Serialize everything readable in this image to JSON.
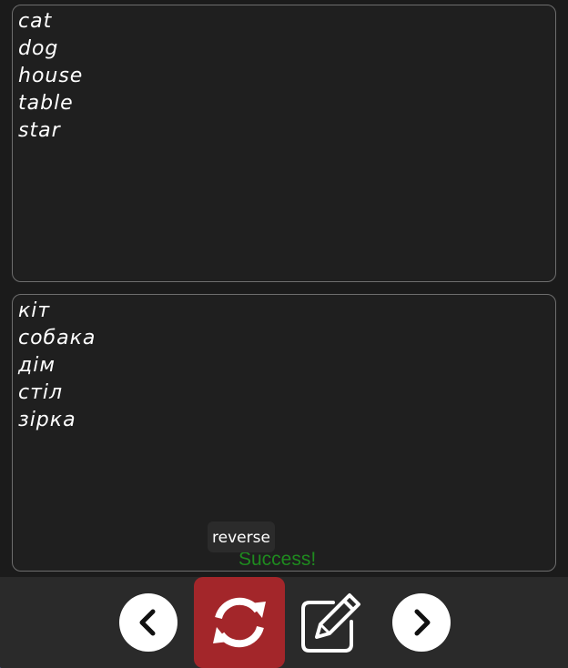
{
  "source_words": [
    "cat",
    "dog",
    "house",
    "table",
    "star"
  ],
  "target_words": [
    "кіт",
    "собака",
    "дім",
    "стіл",
    "зірка"
  ],
  "tooltip": "reverse",
  "status": "Success!",
  "toolbar": {
    "icons": [
      "chevron-left-icon",
      "sync-icon",
      "edit-icon",
      "chevron-right-icon"
    ]
  },
  "colors": {
    "background": "#1b1b1b",
    "textbox": "#1f1f1f",
    "border": "#6e6e6e",
    "toolbar": "#2a2a2a",
    "reverse_button": "#a3262a",
    "status": "#1f8a1f"
  }
}
